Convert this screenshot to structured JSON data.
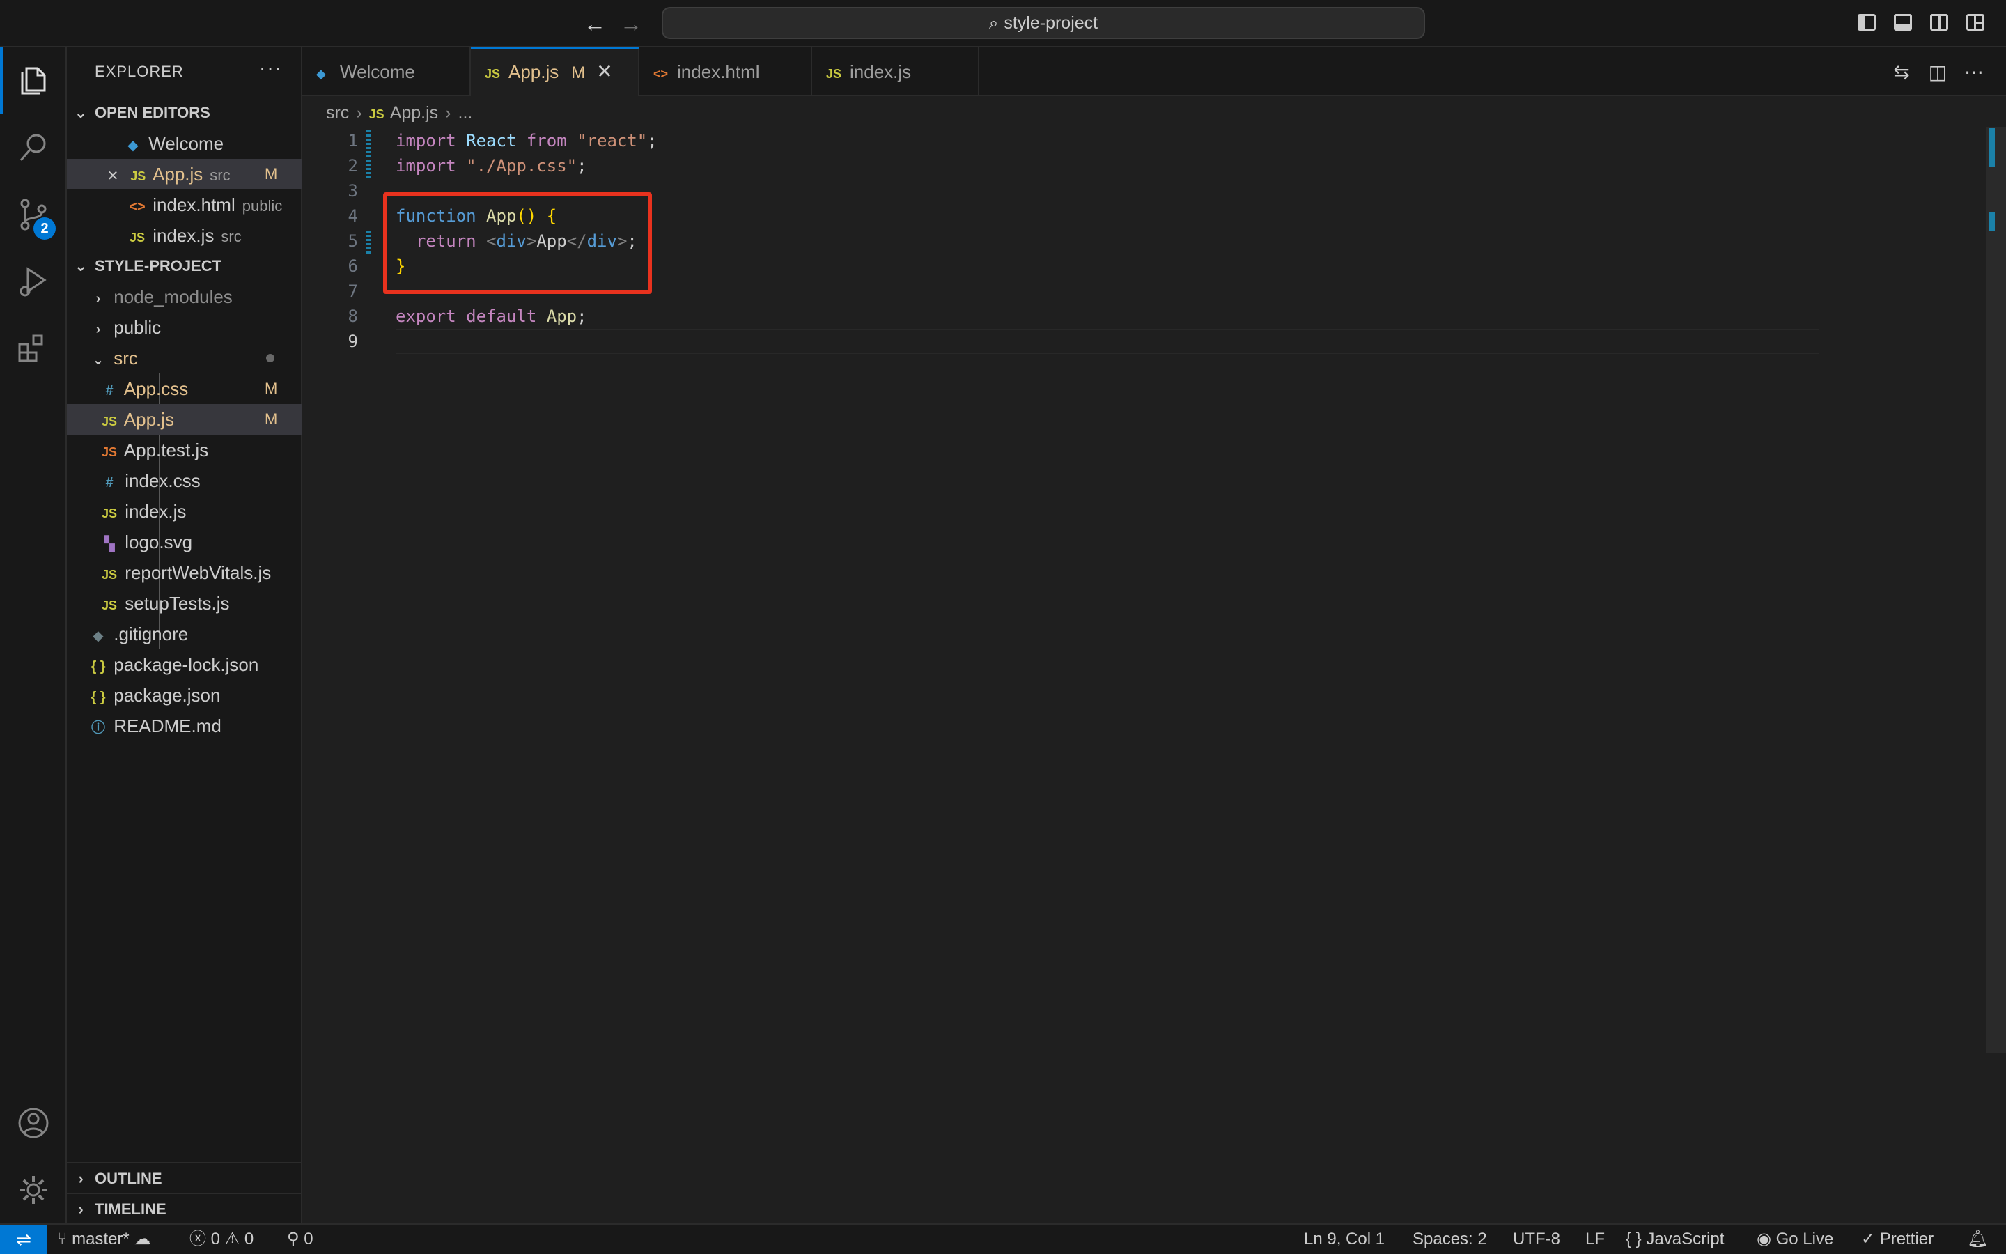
{
  "titlebar": {
    "search_label": "style-project"
  },
  "activity": {
    "scm_badge": "2"
  },
  "sidebar": {
    "title": "EXPLORER",
    "more": "···",
    "open_editors": {
      "label": "OPEN EDITORS",
      "items": [
        {
          "name": "Welcome",
          "desc": ""
        },
        {
          "name": "App.js",
          "desc": "src",
          "mod": "M"
        },
        {
          "name": "index.html",
          "desc": "public"
        },
        {
          "name": "index.js",
          "desc": "src"
        }
      ]
    },
    "project": {
      "label": "STYLE-PROJECT",
      "items": [
        {
          "name": "node_modules"
        },
        {
          "name": "public"
        },
        {
          "name": "src"
        },
        {
          "name": "App.css",
          "mod": "M"
        },
        {
          "name": "App.js",
          "mod": "M"
        },
        {
          "name": "App.test.js"
        },
        {
          "name": "index.css"
        },
        {
          "name": "index.js"
        },
        {
          "name": "logo.svg"
        },
        {
          "name": "reportWebVitals.js"
        },
        {
          "name": "setupTests.js"
        },
        {
          "name": ".gitignore"
        },
        {
          "name": "package-lock.json"
        },
        {
          "name": "package.json"
        },
        {
          "name": "README.md"
        }
      ]
    },
    "outline": "OUTLINE",
    "timeline": "TIMELINE"
  },
  "icons": {
    "js": "JS",
    "css": "#",
    "html": "<>",
    "json": "{ }",
    "info": "ⓘ"
  },
  "tabs": [
    {
      "label": "Welcome"
    },
    {
      "label": "App.js",
      "mod": "M"
    },
    {
      "label": "index.html"
    },
    {
      "label": "index.js"
    }
  ],
  "breadcrumb": {
    "folder": "src",
    "file": "App.js",
    "more": "..."
  },
  "editor": {
    "line_numbers": [
      "1",
      "2",
      "3",
      "4",
      "5",
      "6",
      "7",
      "8",
      "9"
    ],
    "code": {
      "l1": {
        "k": "import",
        "id": "React",
        "k2": "from",
        "s": "\"react\"",
        "p": ";"
      },
      "l2": {
        "k": "import",
        "s": "\"./App.css\"",
        "p": ";"
      },
      "l4": {
        "k": "function",
        "fn": "App",
        "paren": "()",
        "br": "{"
      },
      "l5": {
        "k": "return",
        "lt": "<",
        "tag": "div",
        "gt": ">",
        "text": "App",
        "lt2": "</",
        "tag2": "div",
        "gt2": ">",
        "p": ";"
      },
      "l6": {
        "br": "}"
      },
      "l8": {
        "k": "export",
        "k2": "default",
        "fn": "App",
        "p": ";"
      }
    }
  },
  "status": {
    "branch": "master*",
    "errors": "0",
    "warnings": "0",
    "ports": "0",
    "position": "Ln 9, Col 1",
    "spaces": "Spaces: 2",
    "encoding": "UTF-8",
    "eol": "LF",
    "language_icon": "{ }",
    "language": "JavaScript",
    "golive": "Go Live",
    "prettier": "Prettier"
  }
}
